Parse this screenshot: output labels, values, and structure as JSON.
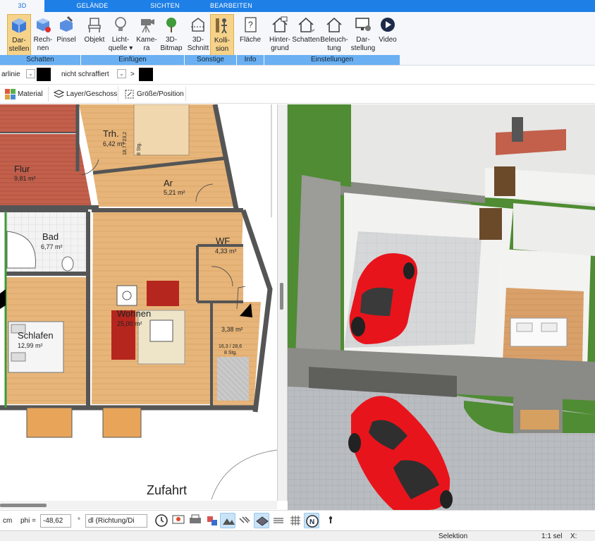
{
  "ribbon_tabs": [
    "3D",
    "GELÄNDE",
    "SICHTEN",
    "BEARBEITEN"
  ],
  "ribbon": {
    "buttons": {
      "darstellen": "Dar-\nstellen",
      "rechnen": "Rech-\nnen",
      "pinsel": "Pinsel",
      "objekt": "Objekt",
      "lichtquelle": "Licht-\nquelle ▾",
      "kamera": "Kame-\nra",
      "bitmap3d": "3D-\nBitmap",
      "schnitt3d": "3D-\nSchnitt",
      "kollision": "Kolli-\nsion",
      "flaeche": "Fläche",
      "hintergrund": "Hinter-\ngrund",
      "schatten": "Schatten",
      "beleuchtung": "Beleuch-\ntung",
      "darstellung": "Dar-\nstellung",
      "video": "Video"
    },
    "groups": {
      "schatten": "Schatten",
      "einfuegen": "Einfügen",
      "sonstige": "Sonstige",
      "info": "Info",
      "einstellungen": "Einstellungen"
    }
  },
  "propbar": {
    "line_label": "arlinie",
    "hatch_label": "nicht schraffiert",
    "arrow": ">"
  },
  "toolbar2": {
    "material": "Material",
    "layer": "Layer/Geschoss",
    "groesse": "Größe/Position"
  },
  "plan": {
    "rooms": {
      "flur": {
        "name": "Flur",
        "area": "9,81 m²"
      },
      "trh": {
        "name": "Trh.",
        "area": "6,42 m²"
      },
      "ar": {
        "name": "Ar",
        "area": "5,21 m²"
      },
      "bad": {
        "name": "Bad",
        "area": "6,77 m²"
      },
      "wf": {
        "name": "WF",
        "area": "4,33 m²"
      },
      "wohnen": {
        "name": "Wohnen",
        "area": "25,00 m²"
      },
      "schlafen": {
        "name": "Schlafen",
        "area": "12,99 m²"
      },
      "stair": {
        "area": "3,38 m²"
      }
    },
    "stair_note_top": "18,7 / 23,2",
    "stair_note_top2": "8 Stg.",
    "stair_note_bottom": "16,3 / 28,6",
    "stair_note_bottom2": "8 Stg.",
    "driveway": "Zufahrt"
  },
  "bottombar": {
    "unit": "cm",
    "phi_label": "phi =",
    "phi_value": "-48,62",
    "degree": "°",
    "direction": "dl (Richtung/Di"
  },
  "statusbar": {
    "mode": "Selektion",
    "scale": "1:1 sel",
    "x_label": "X:"
  },
  "colors": {
    "ribbon_blue": "#1e7fe6",
    "group_blue": "#6ab0f2",
    "selected_button": "#f6d38a",
    "car_red": "#e8141c",
    "lawn_green": "#4f8c33"
  }
}
